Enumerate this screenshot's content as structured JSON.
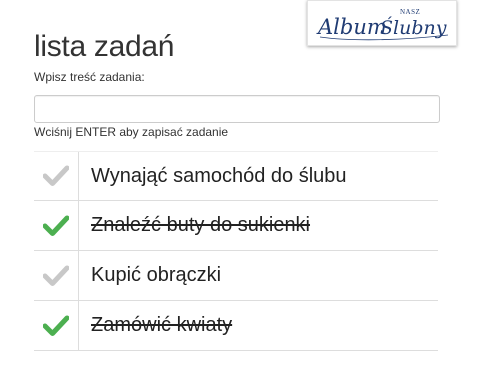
{
  "app": {
    "title": "lista zadań",
    "logo": {
      "top": "NASZ",
      "main": "Album Ślubny"
    }
  },
  "form": {
    "label": "Wpisz treść zadania:",
    "value": "",
    "placeholder": "",
    "hint": "Wciśnij ENTER aby zapisać zadanie"
  },
  "tasks": [
    {
      "text": "Wynająć samochód do ślubu",
      "done": false
    },
    {
      "text": "Znaleźć buty do sukienki",
      "done": true
    },
    {
      "text": "Kupić obrączki",
      "done": false
    },
    {
      "text": "Zamówić kwiaty",
      "done": true
    }
  ],
  "colors": {
    "check_done": "#4caf50",
    "check_pending": "#c8c8c8",
    "logo_ink": "#1f3b73"
  },
  "icons": {
    "check": "checkmark-icon"
  }
}
